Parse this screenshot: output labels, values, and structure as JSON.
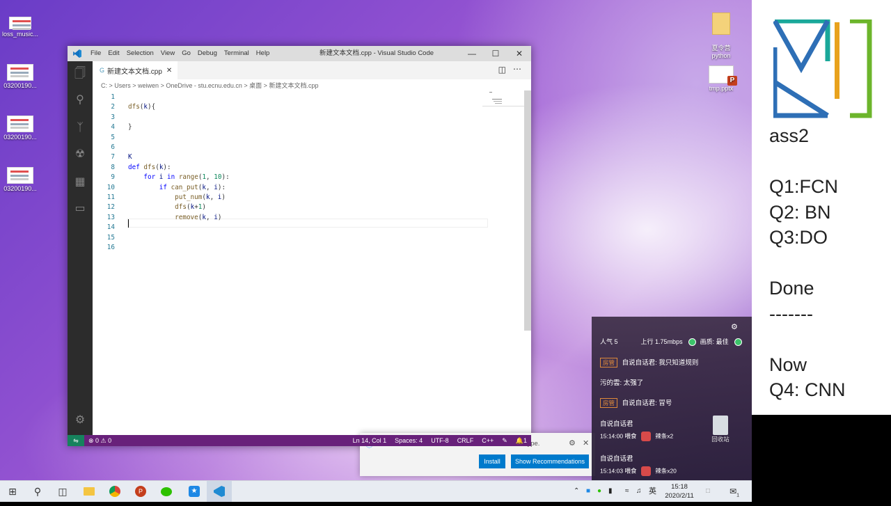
{
  "desktop": {
    "icons": [
      {
        "label": "loss_music..."
      },
      {
        "label": "03200190..."
      },
      {
        "label": "03200190..."
      },
      {
        "label": "03200190..."
      },
      {
        "label": "夏令营\npython"
      },
      {
        "label": "tmp.pptx"
      }
    ]
  },
  "vscode": {
    "window_title": "新建文本文档.cpp - Visual Studio Code",
    "menu": [
      "File",
      "Edit",
      "Selection",
      "View",
      "Go",
      "Debug",
      "Terminal",
      "Help"
    ],
    "tab_label": "新建文本文档.cpp",
    "breadcrumb": [
      "C:",
      "Users",
      "weiwen",
      "OneDrive - stu.ecnu.edu.cn",
      "桌面",
      "新建文本文档.cpp"
    ],
    "code_lines": [
      "",
      "dfs(k){",
      "",
      "}",
      "",
      "",
      "K",
      "def dfs(k):",
      "    for i in range(1, 10):",
      "        if can_put(k, i):",
      "            put_num(k, i)",
      "            dfs(k+1)",
      "            remove(k, i)",
      "",
      "",
      ""
    ],
    "notification": {
      "message": "The 'C/C++' extension is recommended for this file type.",
      "install_label": "Install",
      "show_label": "Show Recommendations"
    },
    "status": {
      "errors": "⊗ 0 ⚠ 0",
      "position": "Ln 14, Col 1",
      "spaces": "Spaces: 4",
      "encoding": "UTF-8",
      "eol": "CRLF",
      "language": "C++",
      "bell_count": "1"
    }
  },
  "notes": {
    "lines": [
      "ass2",
      "Q1:FCN",
      "Q2: BN",
      "Q3:DO",
      "Done",
      "-------",
      "Now",
      "Q4: CNN"
    ]
  },
  "chat": {
    "popularity": "人气  5",
    "upload": "上行  1.75mbps",
    "quality": "画质: 最佳",
    "messages": [
      {
        "badge": "房管",
        "text": "自说自话君: 我只知道规则"
      },
      {
        "text": "污的雲: 太强了"
      },
      {
        "badge": "房管",
        "text": "自说自话君: 冒号"
      }
    ],
    "gifts": [
      {
        "user": "自说自话君",
        "time": "15:14:00 喂食",
        "gift": "辣条x2"
      },
      {
        "user": "自说自话君",
        "time": "15:14:03 喂食",
        "gift": "辣条x20"
      }
    ],
    "recycle_label": "回收站"
  },
  "taskbar": {
    "ime": "英",
    "time": "15:18",
    "date": "2020/2/11",
    "notification_count": "1"
  }
}
